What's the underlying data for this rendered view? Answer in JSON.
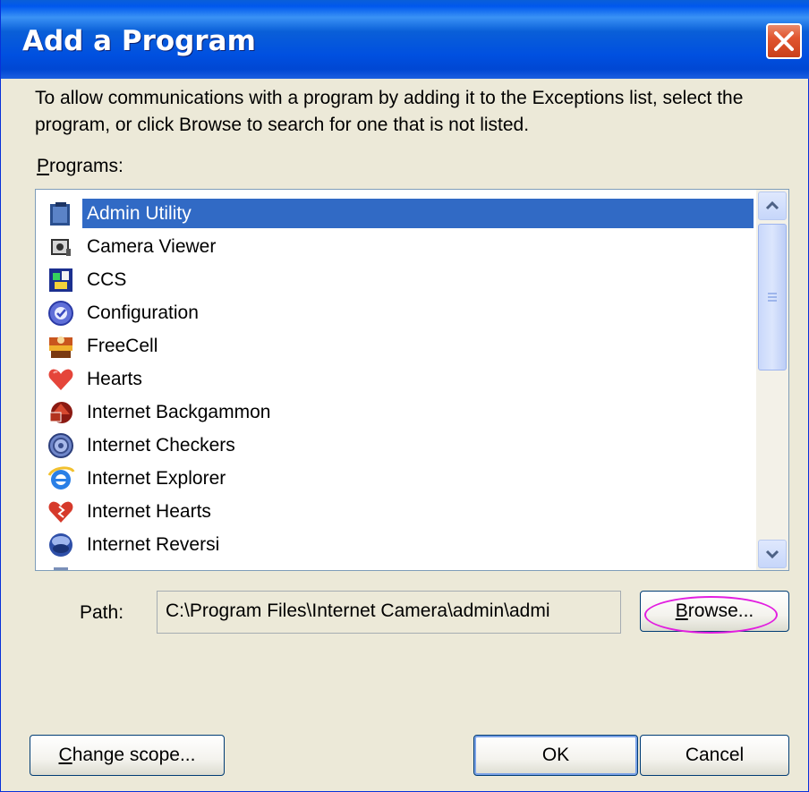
{
  "window": {
    "title": "Add a Program",
    "close_label": "×"
  },
  "description": "To allow communications with a program by adding it to the Exceptions list, select the program, or click Browse to search for one that is not listed.",
  "programs": {
    "label_prefix": "P",
    "label_rest": "rograms:",
    "items": [
      {
        "label": "Admin Utility",
        "icon": "admin-utility-icon",
        "selected": true
      },
      {
        "label": "Camera Viewer",
        "icon": "camera-viewer-icon"
      },
      {
        "label": "CCS",
        "icon": "ccs-icon"
      },
      {
        "label": "Configuration",
        "icon": "configuration-icon"
      },
      {
        "label": "FreeCell",
        "icon": "freecell-icon"
      },
      {
        "label": "Hearts",
        "icon": "hearts-icon"
      },
      {
        "label": "Internet Backgammon",
        "icon": "internet-backgammon-icon"
      },
      {
        "label": "Internet Checkers",
        "icon": "internet-checkers-icon"
      },
      {
        "label": "Internet Explorer",
        "icon": "internet-explorer-icon"
      },
      {
        "label": "Internet Hearts",
        "icon": "internet-hearts-icon"
      },
      {
        "label": "Internet Reversi",
        "icon": "internet-reversi-icon"
      }
    ]
  },
  "path": {
    "label": "Path:",
    "value": "C:\\Program Files\\Internet Camera\\admin\\admi"
  },
  "buttons": {
    "browse_prefix": "B",
    "browse_rest": "rowse...",
    "change_scope_prefix": "C",
    "change_scope_rest": "hange scope...",
    "ok": "OK",
    "cancel": "Cancel"
  },
  "colors": {
    "titlebar": "#0058ee",
    "selection": "#316ac5",
    "highlight_circle": "#e21ee0",
    "dialog_bg": "#ece9d8"
  }
}
